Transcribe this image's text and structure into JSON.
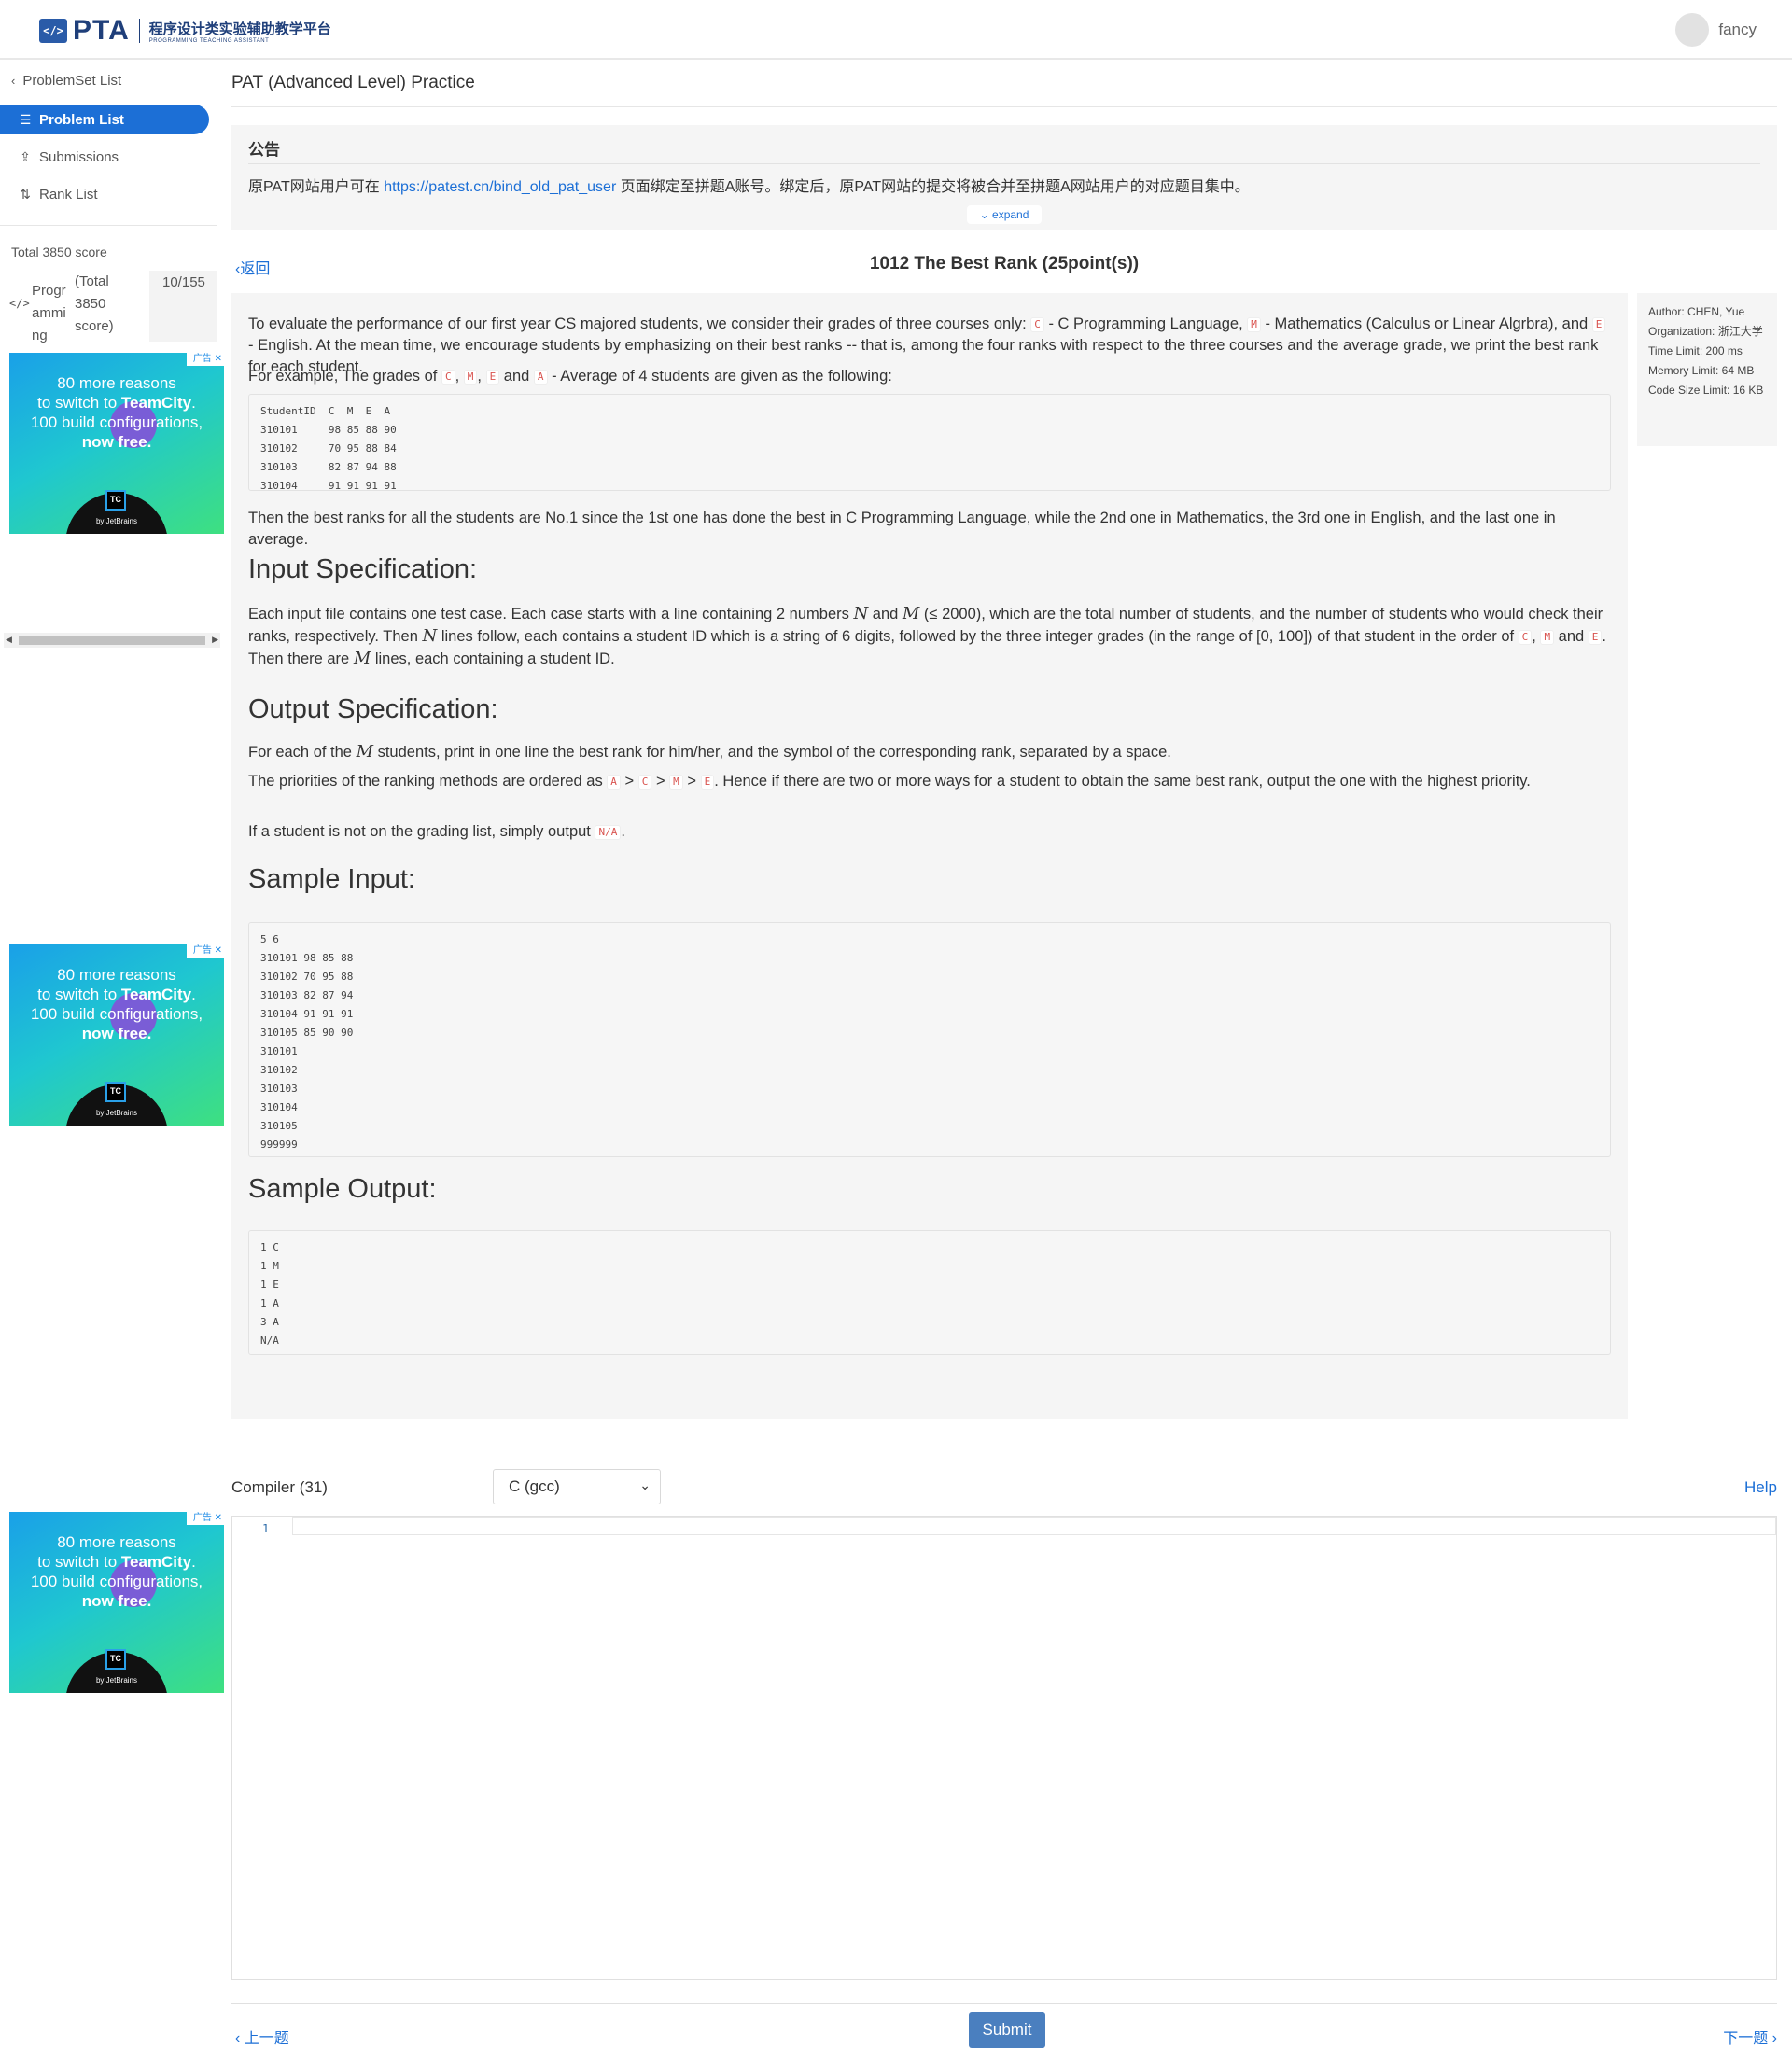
{
  "header": {
    "logo_mark": "</>",
    "logo_text": "PTA",
    "logo_cn": "程序设计类实验辅助教学平台",
    "logo_en": "PROGRAMMING TEACHING ASSISTANT",
    "username": "fancy"
  },
  "sidebar": {
    "back_label": "ProblemSet List",
    "items": [
      {
        "label": "Problem List",
        "icon": "list-icon",
        "active": true
      },
      {
        "label": "Submissions",
        "icon": "upload-icon",
        "active": false
      },
      {
        "label": "Rank List",
        "icon": "sort-icon",
        "active": false
      }
    ],
    "total_score": "Total 3850 score",
    "score_row": {
      "code_icon": "</>",
      "name": "Programming",
      "total": "(Total 3850 score)",
      "count": "10/155"
    }
  },
  "ads": {
    "ad_mark": "广告",
    "line1": "80 more reasons",
    "line2a": "to switch to ",
    "line2b": "TeamCity",
    "line3": "100 build configurations,",
    "line4": "now free.",
    "badge": "TC",
    "by": "by JetBrains"
  },
  "breadcrumb": {
    "title": "PAT (Advanced Level) Practice"
  },
  "notice": {
    "title": "公告",
    "text_before": "原PAT网站用户可在 ",
    "link": "https://patest.cn/bind_old_pat_user",
    "text_after": " 页面绑定至拼题A账号。绑定后，原PAT网站的提交将被合并至拼题A网站用户的对应题目集中。",
    "expand_label": "expand"
  },
  "problem": {
    "back_label": "返回",
    "title": "1012 The Best Rank (25point(s))",
    "p1a": "To evaluate the performance of our first year CS majored students, we consider their grades of three courses only: ",
    "p1b": " - C Programming Language, ",
    "p1c": " - Mathematics (Calculus or Linear Algrbra), and ",
    "p1d": " - English. At the mean time, we encourage students by emphasizing on their best ranks -- that is, among the four ranks with respect to the three courses and the average grade, we print the best rank for each student.",
    "p2a": "For example, The grades of ",
    "p2b": " and ",
    "p2c": " - Average of 4 students are given as the following:",
    "code_C": "C",
    "code_M": "M",
    "code_E": "E",
    "code_A": "A",
    "code_NA": "N/A",
    "example_table": "StudentID  C  M  E  A\n310101     98 85 88 90\n310102     70 95 88 84\n310103     82 87 94 88\n310104     91 91 91 91",
    "p3": "Then the best ranks for all the students are No.1 since the 1st one has done the best in C Programming Language, while the 2nd one in Mathematics, the 3rd one in English, and the last one in average.",
    "h_input": "Input Specification:",
    "in_a": "Each input file contains one test case. Each case starts with a line containing 2 numbers ",
    "in_b": " and ",
    "in_c": " (≤ 2000), which are the total number of students, and the number of students who would check their ranks, respectively. Then ",
    "in_d": " lines follow, each contains a student ID which is a string of 6 digits, followed by the three integer grades (in the range of [0, 100]) of that student in the order of ",
    "in_e": ", ",
    "in_f": " and ",
    "in_g": ". Then there are ",
    "in_h": " lines, each containing a student ID.",
    "var_N": "N",
    "var_M": "M",
    "h_output": "Output Specification:",
    "out1a": "For each of the ",
    "out1b": " students, print in one line the best rank for him/her, and the symbol of the corresponding rank, separated by a space.",
    "out2a": "The priorities of the ranking methods are ordered as ",
    "gt": " > ",
    "out2b": ". Hence if there are two or more ways for a student to obtain the same best rank, output the one with the highest priority.",
    "out3a": "If a student is not on the grading list, simply output ",
    "out3b": ".",
    "h_sample_in": "Sample Input:",
    "sample_input": "5 6\n310101 98 85 88\n310102 70 95 88\n310103 82 87 94\n310104 91 91 91\n310105 85 90 90\n310101\n310102\n310103\n310104\n310105\n999999",
    "h_sample_out": "Sample Output:",
    "sample_output": "1 C\n1 M\n1 E\n1 A\n3 A\nN/A"
  },
  "info": {
    "author": "Author: CHEN, Yue",
    "organization": "Organization: 浙江大学",
    "time_limit": "Time Limit: 200 ms",
    "memory_limit": "Memory Limit: 64 MB",
    "code_size_limit": "Code Size Limit: 16 KB"
  },
  "compiler": {
    "label": "Compiler (31)",
    "selected": "C (gcc)",
    "help": "Help"
  },
  "editor": {
    "line_number": "1"
  },
  "footer": {
    "prev": "上一题",
    "submit": "Submit",
    "next": "下一题"
  }
}
